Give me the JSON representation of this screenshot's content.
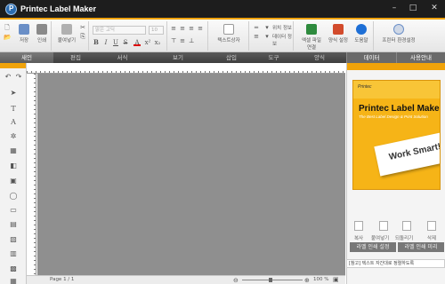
{
  "app": {
    "title": "Printec Label Maker"
  },
  "window": {
    "min": "–",
    "max": "□",
    "close": "✕"
  },
  "toolbar": {
    "new": "새로",
    "save": "저장",
    "print": "인쇄",
    "paste": "붙여넣기",
    "font_placeholder": "맑은 고딕",
    "size_placeholder": "10",
    "bold": "B",
    "italic": "I",
    "underline": "U",
    "strike": "S",
    "textcolor": "A",
    "text_box": "텍스트상자",
    "line_style": "선 모양",
    "position_info": "위치 정보",
    "data_info": "데이터 정보",
    "db_connect": "DB 연결",
    "excel_link": "엑셀 파일 연결",
    "format": "양식 설정",
    "help": "도움말",
    "printer_settings": "프린터 환경설정"
  },
  "tabs": [
    "새인",
    "편집",
    "서식",
    "보기",
    "삽입",
    "도구",
    "양식"
  ],
  "right_tabs": [
    "데이터",
    "사용안내"
  ],
  "status": {
    "page": "Page 1 / 1",
    "zoom": "100 %"
  },
  "promo": {
    "logo": "Printec",
    "title": "Printec Label Maker",
    "subtitle": "The Best Label Design & Print Solution",
    "card": "Work Smart!"
  },
  "right_panel": {
    "actions": [
      "복사",
      "붙여넣기",
      "되돌리기",
      "삭제"
    ],
    "buttons": [
      "라벨 인쇄 설정",
      "라벨 인쇄 미리"
    ],
    "footer": "[참고] 텍스트 자간대로 정렬하도록"
  },
  "colors": {
    "accent": "#f0a30a",
    "titlebar": "#1d1d1d",
    "canvas": "#8f8f8f"
  }
}
